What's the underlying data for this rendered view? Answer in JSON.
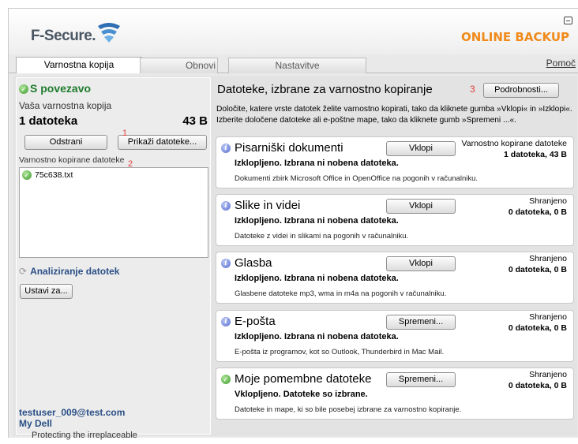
{
  "app": {
    "brand": "F-Secure.",
    "product": "ONLINE BACKUP",
    "tagline": "Protecting the irreplaceable"
  },
  "tabs": [
    {
      "label": "Varnostna kopija",
      "active": true
    },
    {
      "label": "Obnovi",
      "active": false
    },
    {
      "label": "Nastavitve",
      "active": false
    }
  ],
  "help_label": "Pomoč",
  "left": {
    "status": "S povezavo",
    "backup_label": "Vaša varnostna kopija",
    "file_count": "1 datoteka",
    "file_size": "43 B",
    "remove_label": "Odstrani",
    "show_files_label": "Prikaži datoteke...",
    "files_label": "Varnostno kopirane datoteke",
    "files": [
      "75c638.txt"
    ],
    "analyzing_label": "Analiziranje datotek",
    "set_for_label": "Ustavi za...",
    "user_email": "testuser_009@test.com",
    "user_name": "My Dell"
  },
  "markers": [
    "1",
    "2",
    "3"
  ],
  "right": {
    "title": "Datoteke, izbrane za varnostno kopiranje",
    "details_label": "Podrobnosti...",
    "description": "Določite, katere vrste datotek želite varnostno kopirati, tako da kliknete gumba »Vklopi« in »Izklopi«. Izberite določene datoteke ali e-poštne mape, tako da kliknete gumb »Spremeni ...«.",
    "cards": [
      {
        "icon": "info-icon",
        "title": "Pisarniški dokumenti",
        "button": "Vklopi",
        "status": "Izklopljeno. Izbrana ni nobena datoteka.",
        "desc": "Dokumenti zbirk Microsoft Office in OpenOffice na pogonih v računalniku.",
        "stat_label": "Varnostno kopirane datoteke",
        "stat_value": "1 datoteka, 43 B"
      },
      {
        "icon": "info-icon",
        "title": "Slike in videi",
        "button": "Vklopi",
        "status": "Izklopljeno. Izbrana ni nobena datoteka.",
        "desc": "Datoteke z videi in slikami na pogonih v računalniku.",
        "stat_label": "Shranjeno",
        "stat_value": "0 datoteka, 0 B"
      },
      {
        "icon": "info-icon",
        "title": "Glasba",
        "button": "Vklopi",
        "status": "Izklopljeno. Izbrana ni nobena datoteka.",
        "desc": "Glasbene datoteke mp3, wma in m4a na pogonih v računalniku.",
        "stat_label": "Shranjeno",
        "stat_value": "0 datoteka, 0 B"
      },
      {
        "icon": "info-icon",
        "title": "E-pošta",
        "button": "Spremeni...",
        "status": "Izklopljeno. Izbrana ni nobena datoteka.",
        "desc": "E-pošta iz programov, kot so Outlook, Thunderbird in Mac Mail.",
        "stat_label": "Shranjeno",
        "stat_value": "0 datoteka, 0 B"
      },
      {
        "icon": "check-icon",
        "title": "Moje pomembne datoteke",
        "button": "Spremeni...",
        "status": "Vklopljeno. Datoteke so izbrane.",
        "desc": "Datoteke in mape, ki so bile posebej izbrane za varnostno kopiranje.",
        "stat_label": "Shranjeno",
        "stat_value": "0 datoteka, 0 B"
      }
    ]
  },
  "colors": {
    "brand_orange": "#f08a1a",
    "status_green": "#1e7b2c",
    "link_blue": "#2a4f86",
    "marker_red": "#e23b3b"
  }
}
